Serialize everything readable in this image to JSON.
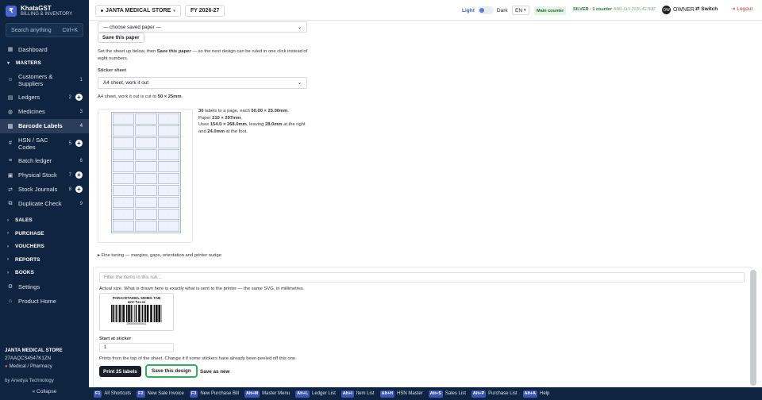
{
  "brand": {
    "logo": "₹",
    "name": "KhataGST",
    "tagline": "BILLING & INVENTORY"
  },
  "search": {
    "placeholder": "Search anything",
    "shortcut": "Ctrl+K"
  },
  "sidebar": {
    "dashboard": "Dashboard",
    "masters": "MASTERS",
    "items": [
      {
        "label": "Customers & Suppliers",
        "count": "1"
      },
      {
        "label": "Ledgers",
        "count": "2"
      },
      {
        "label": "Medicines",
        "count": "3"
      },
      {
        "label": "Barcode Labels",
        "count": "4"
      },
      {
        "label": "HSN / SAC Codes",
        "count": "5"
      },
      {
        "label": "Batch ledger",
        "count": "6"
      },
      {
        "label": "Physical Stock",
        "count": "7"
      },
      {
        "label": "Stock Journals",
        "count": "8"
      },
      {
        "label": "Duplicate Check",
        "count": "9"
      }
    ],
    "groups": [
      "SALES",
      "PURCHASE",
      "VOUCHERS",
      "REPORTS",
      "BOOKS"
    ],
    "settings": "Settings",
    "product_home": "Product Home",
    "store_name": "JANTA MEDICAL STORE",
    "gstin": "27AAQCS4547K1ZN",
    "store_type": "Medical / Pharmacy",
    "by": "by Anedya Technology",
    "collapse": "« Collapse"
  },
  "topbar": {
    "company": "JANTA MEDICAL STORE",
    "fy": "FY 2026-27",
    "light": "Light",
    "dark": "Dark",
    "lang": "EN",
    "main_counter": "Main counter",
    "license": "SILVER · 1 counter",
    "license_code": "ANR-SLV-2026-4E7F87",
    "owner_initials": "OW",
    "owner": "OWNER",
    "switch": "⇄ Switch",
    "logout": "⇥ Logout"
  },
  "paper": {
    "select": "— choose saved paper —",
    "save_btn": "Save this paper",
    "hint_pre": "Set the sheet up below, then ",
    "hint_bold": "Save this paper",
    "hint_post": " — so the next design can be ruled in one click instead of eight numbers.",
    "sticker_label": "Sticker sheet",
    "sticker_value": "A4 sheet, work it out",
    "cut_pre": "A4 sheet, work it out is cut to ",
    "cut_bold": "50 × 25mm",
    "cut_post": ".",
    "info_count": "30",
    "info_a": " labels to a page, each ",
    "info_size": "50.00 × 25.00mm",
    "info_b": ".",
    "info_paper_pre": "Paper ",
    "info_paper": "210 × 297mm",
    "info_paper_post": ".",
    "info_uses_pre": "Uses ",
    "info_uses": "154.0 × 268.0mm",
    "info_uses_mid": ", leaving ",
    "info_right": "28.0mm",
    "info_uses_post": " at the right and ",
    "info_foot": "24.0mm",
    "info_end": " at the foot.",
    "fine_tuning": "▸ Fine tuning — margins, gaps, orientation and printer nudge"
  },
  "lower": {
    "filter_placeholder": "Filter the items in this run...",
    "actual_size": "Actual size. What is drawn here is exactly what is sent to the printer — the same SVG, in millimetres.",
    "product_name": "PARACETAMOL 500MG TAB",
    "mrp": "MRP ₹20.00",
    "barcode_number": "2000000000011",
    "start_label": "Start at sticker",
    "start_value": "1",
    "start_hint": "Prints from the top of the sheet. Change it if some stickers have already been peeled off this one.",
    "print_btn": "Print 25 labels",
    "save_design_btn": "Save this design",
    "save_as_btn": "Save as new"
  },
  "footer": [
    {
      "key": "F1",
      "label": "All Shortcuts"
    },
    {
      "key": "F2",
      "label": "New Sale Invoice"
    },
    {
      "key": "F3",
      "label": "New Purchase Bill"
    },
    {
      "key": "Alt+M",
      "label": "Master Menu"
    },
    {
      "key": "Alt+L",
      "label": "Ledger List"
    },
    {
      "key": "Alt+I",
      "label": "Item List"
    },
    {
      "key": "Alt+H",
      "label": "HSN Master"
    },
    {
      "key": "Alt+S",
      "label": "Sales List"
    },
    {
      "key": "Alt+P",
      "label": "Purchase List"
    },
    {
      "key": "Alt+A",
      "label": "Help"
    }
  ],
  "colors": {
    "sidebar": "#0f2440",
    "accent": "#3b55b8",
    "highlight": "#2bb35a"
  }
}
